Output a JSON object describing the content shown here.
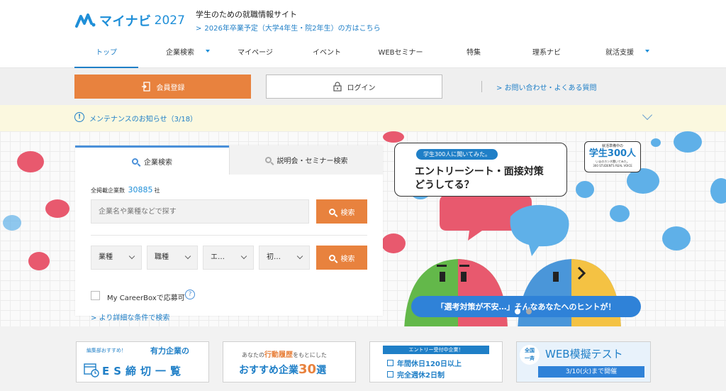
{
  "header": {
    "logo_text": "マイナビ",
    "logo_year": "2027",
    "tagline": "学生のための就職情報サイト",
    "sublink": "2026年卒業予定（大学4年生・院2年生）の方はこちら"
  },
  "nav": {
    "items": [
      {
        "label": "トップ"
      },
      {
        "label": "企業検索"
      },
      {
        "label": "マイページ"
      },
      {
        "label": "イベント"
      },
      {
        "label": "WEBセミナー"
      },
      {
        "label": "特集"
      },
      {
        "label": "理系ナビ"
      },
      {
        "label": "就活支援"
      }
    ]
  },
  "auth": {
    "register_label": "会員登録",
    "login_label": "ログイン",
    "faq_label": "お問い合わせ・よくある質問"
  },
  "notice": {
    "icon": "!",
    "text": "メンテナンスのお知らせ（3/18）"
  },
  "search": {
    "tab_company": "企業検索",
    "tab_seminar": "説明会・セミナー検索",
    "count_label": "全掲載企業数",
    "count_value": "30885",
    "count_unit": "社",
    "keyword_placeholder": "企業名や業種などで探す",
    "search_label": "検索",
    "selects": [
      "業種",
      "職種",
      "エ…",
      "初…"
    ],
    "checkbox_label": "My CareerBoxで応募可",
    "help": "?",
    "detail_link": "より詳細な条件で検索"
  },
  "hero": {
    "pill": "学生300人に聞いてみた。",
    "title_line1": "エントリーシート・面接対策",
    "title_line2": "どうしてる？",
    "badge_small": "就活準備中の",
    "badge_big": "学生300人",
    "badge_sub": "いまのホンネ聞いてみた。",
    "badge_en": "300 STUDENTS REAL VOICE",
    "hint": "「選考対策が不安…」そんなあなたへのヒントが！"
  },
  "banners": {
    "b1_top": "編集部おすすめ！",
    "b1_accent": "有力企業の",
    "b1_big": "ES締切一覧",
    "b2_top_a": "あなたの",
    "b2_top_b": "行動履歴",
    "b2_top_c": "をもとにした",
    "b2_big": "おすすめ企業",
    "b2_num": "30",
    "b2_suffix": "選",
    "b3_head": "エントリー受付中企業！",
    "b3_l1": "年間休日120日以上",
    "b3_l2": "完全週休2日制",
    "b4_badge_1": "全国",
    "b4_badge_2": "一斉",
    "b4_title": "WEB模擬テスト",
    "b4_date": "3/10(火)まで開催"
  },
  "colors": {
    "brand_blue": "#1f8fd8",
    "orange": "#e8823e",
    "notice_bg": "#fbf8df"
  }
}
